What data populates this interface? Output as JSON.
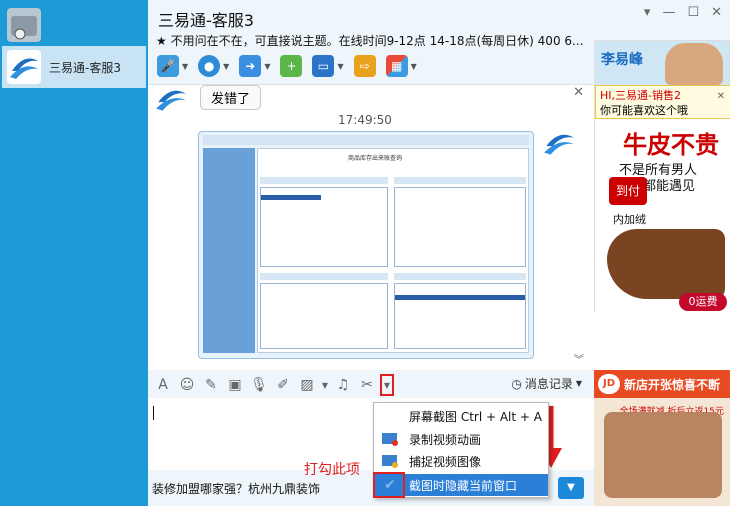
{
  "sidebar": {
    "contacts": [
      {
        "name": "",
        "selected": false
      },
      {
        "name": "三易通-客服3",
        "selected": true
      }
    ]
  },
  "header": {
    "title": "三易通-客服3",
    "notice": "★ 不用问在不在，可直接说主题。在线时间9-12点 14-18点(每周日休) 400 6..."
  },
  "chat": {
    "messages": [
      {
        "type": "text",
        "text": "发错了"
      }
    ],
    "timestamp": "17:49:50",
    "screenshot_title": "商品库存出来账查询"
  },
  "input": {
    "history_label": "消息记录",
    "ad_text": "装修加盟哪家强？杭州九鼎装饰"
  },
  "screenshot_menu": {
    "items": [
      {
        "label": "屏幕截图 Ctrl + Alt + A"
      },
      {
        "label": "录制视频动画"
      },
      {
        "label": "捕捉视频图像"
      },
      {
        "label": "截图时隐藏当前窗口"
      }
    ]
  },
  "annotation": {
    "text": "打勾此项",
    "color": "#e02020"
  },
  "ads": {
    "top": {
      "name": "李易峰",
      "tip_line1": "HI,三易通-销售2",
      "tip_line2": "你可能喜欢这个哦",
      "headline": "牛皮不贵",
      "line1": "不是所有男人",
      "line2": "都能遇见",
      "badge": "到付",
      "line3": "内加绒",
      "shipping": "0运费"
    },
    "bottom": {
      "logo": "JD",
      "headline": "新店开张惊喜不断",
      "sale": "全场满就减 折后立返15元"
    }
  },
  "colors": {
    "sidebar": "#1e9ad6",
    "accent": "#2b7fd6",
    "highlight": "#e02020"
  }
}
